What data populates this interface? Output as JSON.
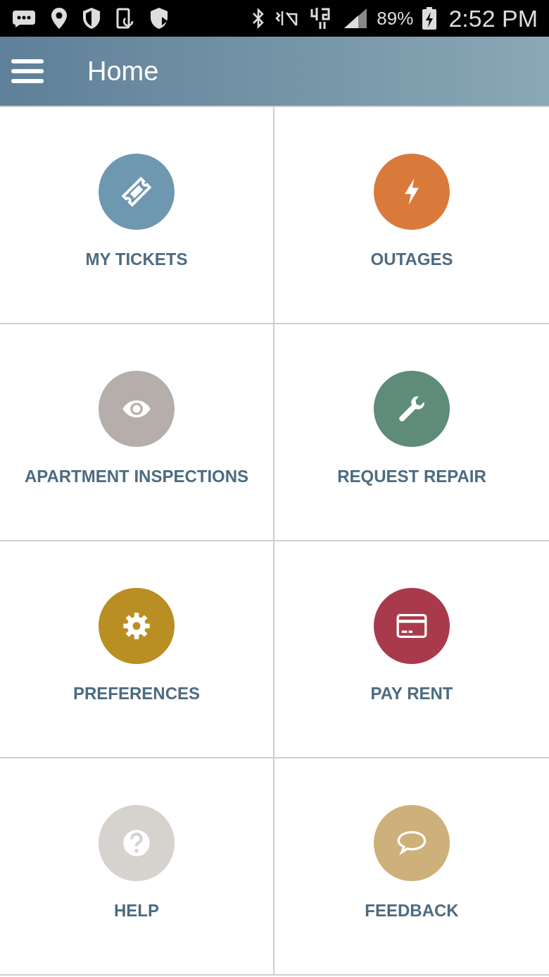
{
  "status_bar": {
    "battery": "89%",
    "time": "2:52 PM"
  },
  "header": {
    "title": "Home"
  },
  "tiles": [
    {
      "label": "MY TICKETS",
      "color": "#6e97b0"
    },
    {
      "label": "OUTAGES",
      "color": "#d97a3b"
    },
    {
      "label": "APARTMENT INSPECTIONS",
      "color": "#b5aeaa"
    },
    {
      "label": "REQUEST REPAIR",
      "color": "#5e8c78"
    },
    {
      "label": "PREFERENCES",
      "color": "#b98e22"
    },
    {
      "label": "PAY RENT",
      "color": "#a93a4c"
    },
    {
      "label": "HELP",
      "color": "#d6d2ce"
    },
    {
      "label": "FEEDBACK",
      "color": "#cdb07a"
    }
  ]
}
